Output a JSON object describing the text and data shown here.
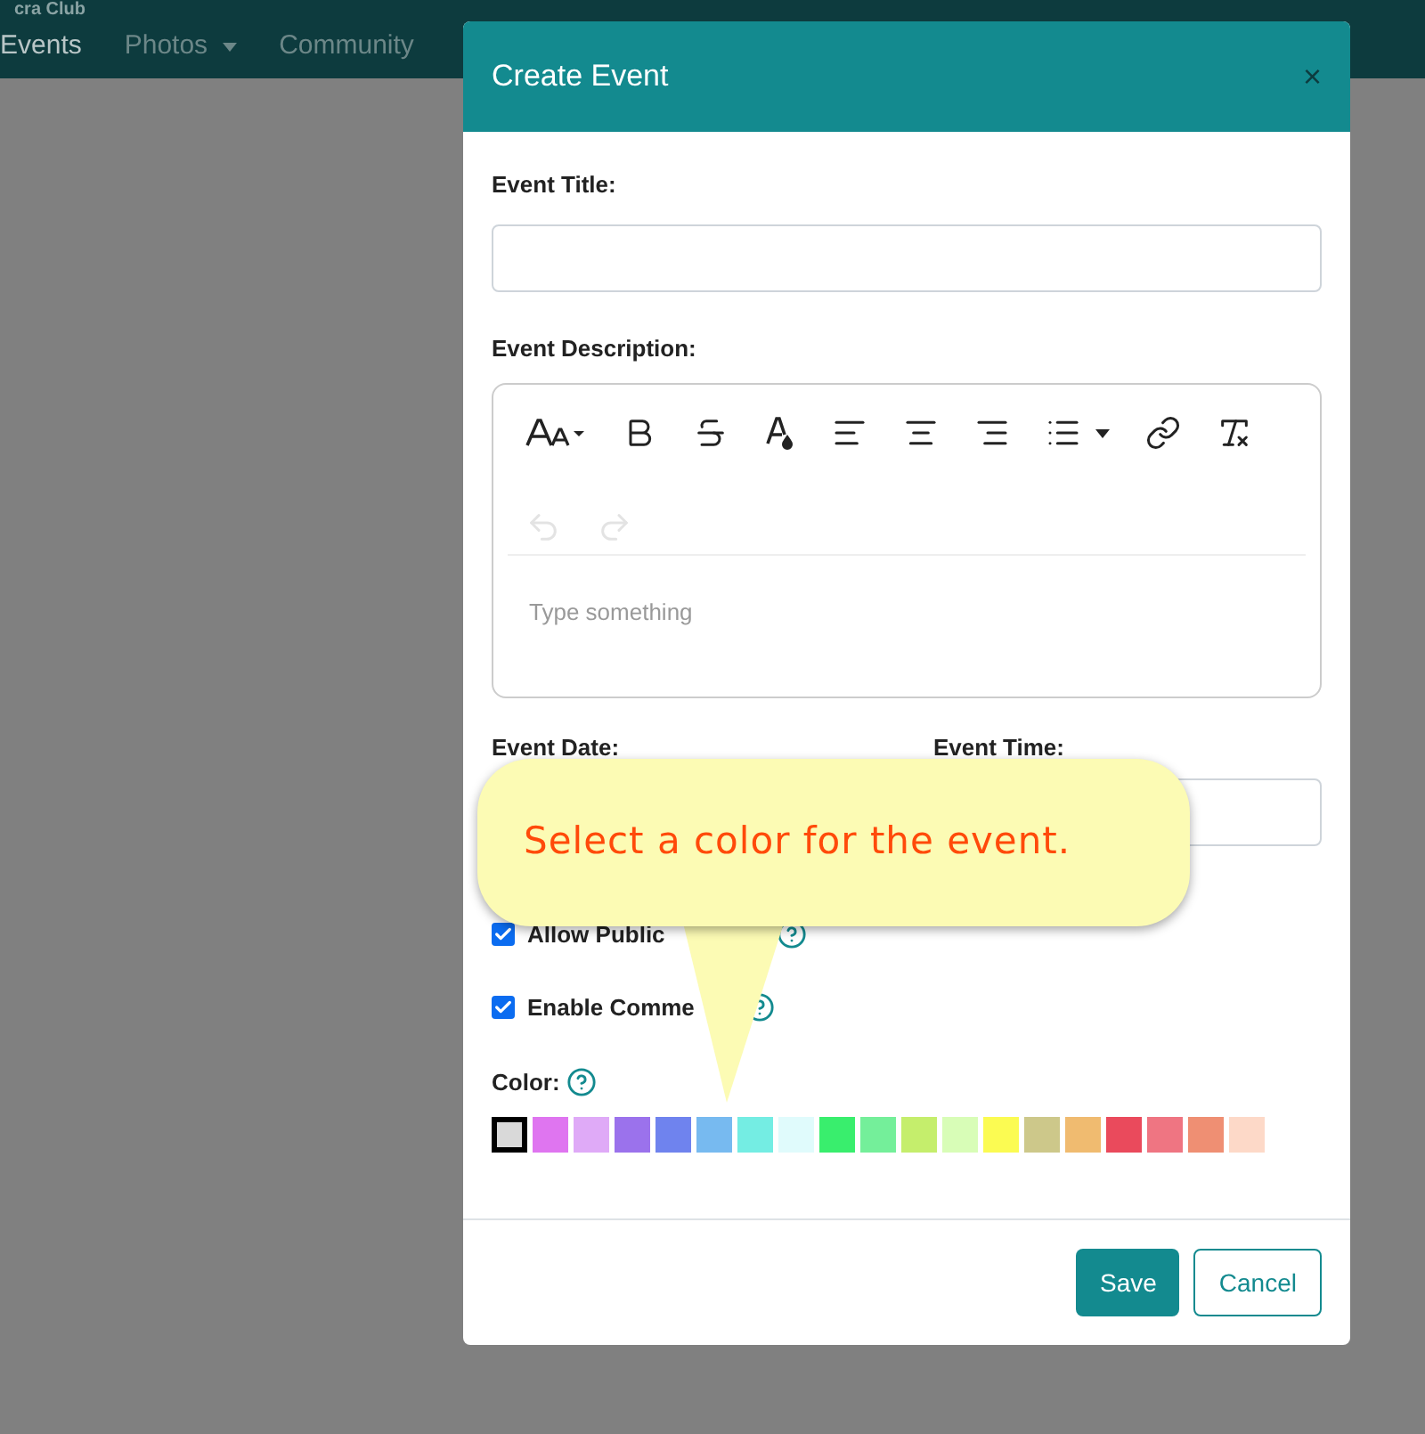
{
  "navbar": {
    "brand": "cra Club",
    "items": [
      {
        "label": "Events",
        "selected": true,
        "dropdown": false
      },
      {
        "label": "Photos",
        "selected": false,
        "dropdown": true
      },
      {
        "label": "Community",
        "selected": false,
        "dropdown": false
      }
    ]
  },
  "dialog": {
    "title": "Create Event",
    "close": "×",
    "title_field": {
      "label": "Event Title:"
    },
    "description": {
      "label": "Event Description:",
      "placeholder": "Type something",
      "toolbar": [
        {
          "kind": "font-size",
          "disabled": false
        },
        {
          "kind": "bold",
          "disabled": false
        },
        {
          "kind": "strikethrough",
          "disabled": false
        },
        {
          "kind": "color",
          "disabled": false
        },
        {
          "kind": "align-left",
          "disabled": false
        },
        {
          "kind": "align-center",
          "disabled": false
        },
        {
          "kind": "align-right",
          "disabled": false
        },
        {
          "kind": "list",
          "disabled": false
        },
        {
          "kind": "link",
          "disabled": false
        },
        {
          "kind": "clear-format",
          "disabled": false
        },
        {
          "kind": "undo",
          "disabled": true
        },
        {
          "kind": "redo",
          "disabled": true
        }
      ]
    },
    "date_label": "Event Date:",
    "time_label": "Event Time:",
    "checkboxes": [
      {
        "label": "Allow Public",
        "checked": true
      },
      {
        "label": "Enable Comme",
        "checked": true
      }
    ],
    "color_label": "Color:",
    "colors": [
      {
        "color": "#d9d9d9",
        "selected": true
      },
      {
        "color": "#df75f0",
        "selected": false
      },
      {
        "color": "#dfaaf7",
        "selected": false
      },
      {
        "color": "#9b72ec",
        "selected": false
      },
      {
        "color": "#6f83ee",
        "selected": false
      },
      {
        "color": "#77baf0",
        "selected": false
      },
      {
        "color": "#74ede3",
        "selected": false
      },
      {
        "color": "#e0fbfc",
        "selected": false
      },
      {
        "color": "#39ee6d",
        "selected": false
      },
      {
        "color": "#74ef9a",
        "selected": false
      },
      {
        "color": "#c5ee6c",
        "selected": false
      },
      {
        "color": "#d8fdb7",
        "selected": false
      },
      {
        "color": "#fbfb52",
        "selected": false
      },
      {
        "color": "#cdc88a",
        "selected": false
      },
      {
        "color": "#f0bb70",
        "selected": false
      },
      {
        "color": "#ea4a5c",
        "selected": false
      },
      {
        "color": "#ef7582",
        "selected": false
      },
      {
        "color": "#ef8f73",
        "selected": false
      },
      {
        "color": "#fdd9c8",
        "selected": false
      }
    ],
    "buttons": [
      {
        "label": "Save",
        "kind": "primary"
      },
      {
        "label": "Cancel",
        "kind": "secondary"
      }
    ]
  },
  "tooltip": {
    "text": "Select a color for the event."
  }
}
